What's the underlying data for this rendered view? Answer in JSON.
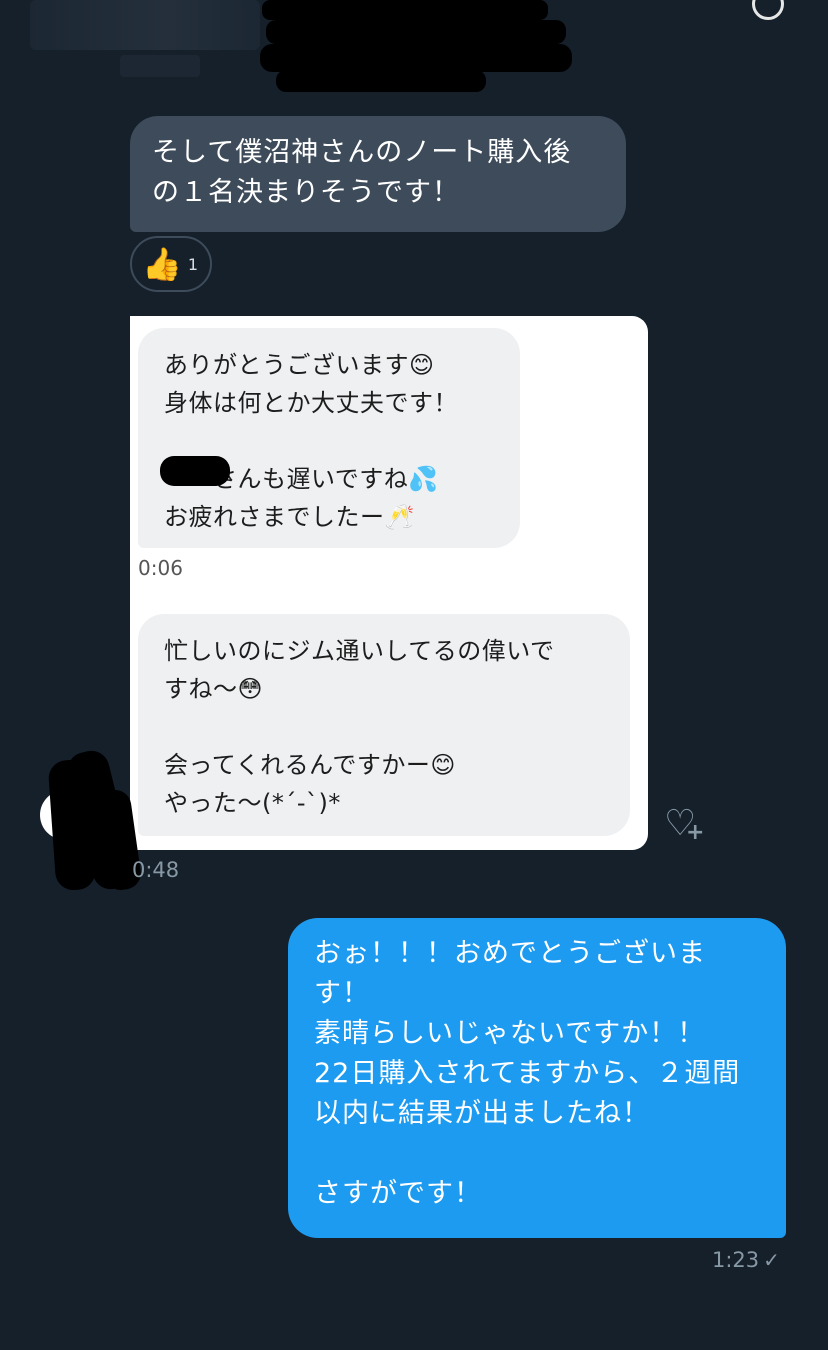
{
  "conversation": {
    "incoming": {
      "lines": [
        "そして僕沼神さんのノート購入後",
        "の１名決まりそうです！"
      ],
      "reaction": {
        "icon": "thumbs-up-icon",
        "emoji": "👍",
        "count": "1"
      }
    },
    "embedded_screenshot": {
      "message1": {
        "lines": [
          "ありがとうございます😊",
          "身体は何とか大丈夫です！",
          "",
          "　　さんも遅いですね💦",
          "お疲れさまでしたー🥂"
        ],
        "time": "0:06"
      },
      "message2": {
        "lines": [
          "忙しいのにジム通いしてるの偉いで",
          "すね〜😳",
          "",
          "会ってくれるんですかー😊",
          "やった〜(*´-`)*"
        ]
      }
    },
    "incoming_time": "0:48",
    "outgoing": {
      "lines": [
        "おぉ！！！おめでとうございま",
        "す！",
        "素晴らしいじゃないですか！！",
        "22日購入されてますから、２週間",
        "以内に結果が出ましたね！",
        "",
        "さすがです！"
      ],
      "time": "1:23",
      "status_icon": "check-icon"
    }
  },
  "colors": {
    "background": "#15202b",
    "incoming_bubble": "#3d4b5a",
    "outgoing_bubble": "#1d9bf0",
    "muted_text": "#8899a6"
  }
}
